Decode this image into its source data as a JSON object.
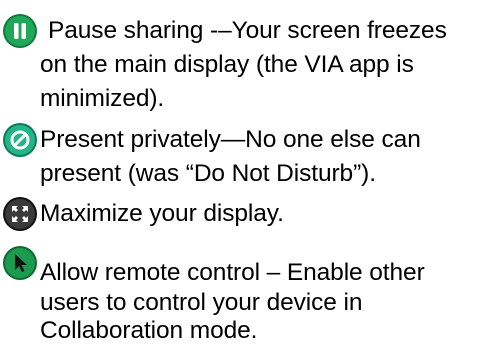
{
  "items": [
    {
      "icon": "pause-icon",
      "lines": [
        "Pause sharing -–Your screen freezes",
        "on the main display (the VIA app is",
        "minimized)."
      ]
    },
    {
      "icon": "present-privately-icon",
      "lines": [
        "Present privately—No one else can",
        "present (was “Do Not Disturb”)."
      ]
    },
    {
      "icon": "maximize-icon",
      "lines": [
        "Maximize your display."
      ]
    },
    {
      "icon": "remote-control-icon",
      "lines": [
        "Allow remote control – Enable other",
        "users to control your device in",
        "Collaboration mode."
      ]
    }
  ],
  "colors": {
    "pause_icon": "#1a9a52",
    "present_privately_icon": "#1aa07a",
    "maximize_icon": "#2b2b2b",
    "remote_control_icon": "#178a4a"
  }
}
